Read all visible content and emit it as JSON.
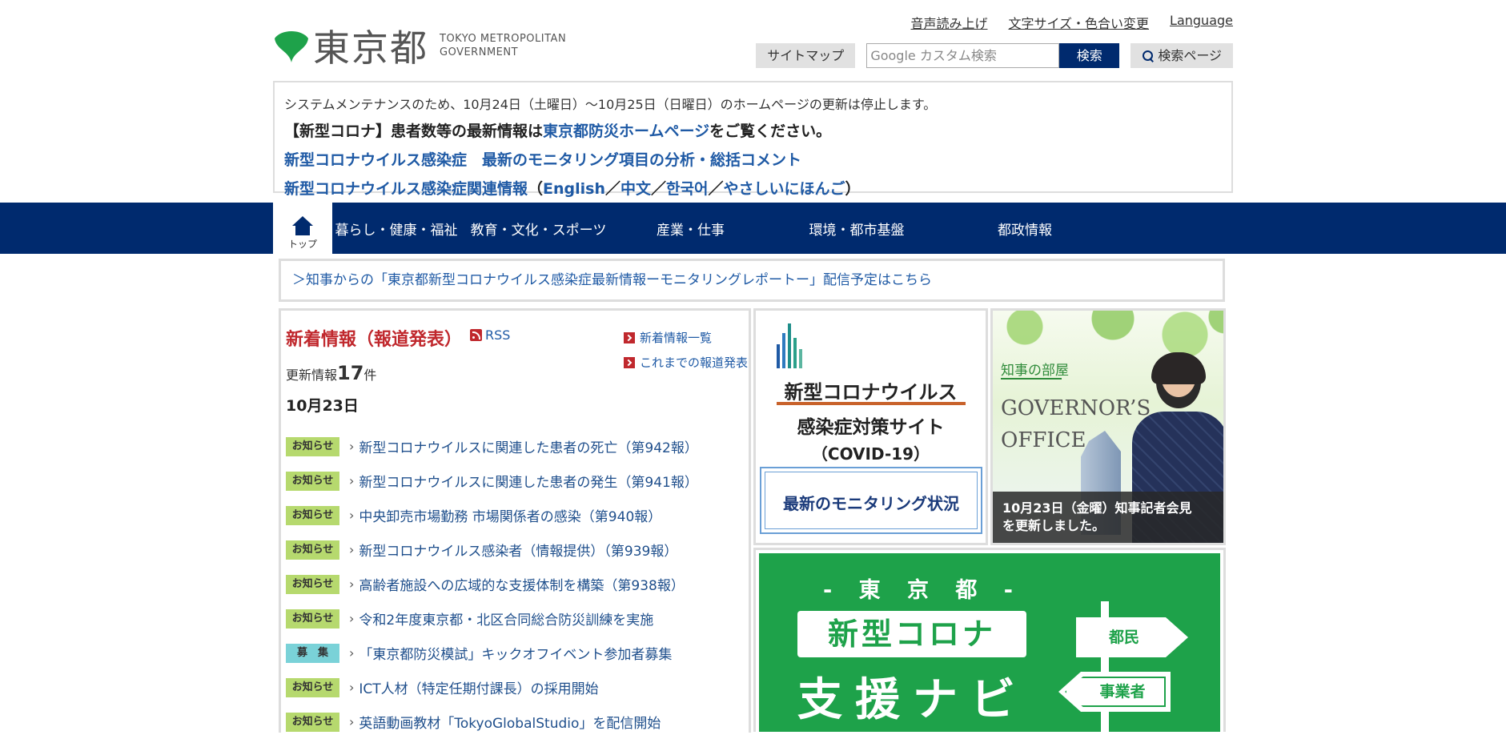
{
  "header": {
    "logo_text": "東京都",
    "logo_en_line1": "TOKYO METROPOLITAN",
    "logo_en_line2": "GOVERNMENT",
    "util_links": [
      "音声読み上げ",
      "文字サイズ・色合い変更",
      "Language"
    ],
    "sitemap_label": "サイトマップ",
    "search_placeholder": "Google カスタム検索",
    "search_button": "検索",
    "search_page_label": "検索ページ"
  },
  "notice": {
    "line1": "システムメンテナンスのため、10月24日（土曜日）～10月25日（日曜日）のホームページの更新は停止します。",
    "line2_pre": "【新型コロナ】患者数等の最新情報は",
    "line2_link": "東京都防災ホームページ",
    "line2_post": "をご覧ください。",
    "line3": "新型コロナウイルス感染症　最新のモニタリング項目の分析・総括コメント",
    "line4_link": "新型コロナウイルス感染症関連情報",
    "line4_open": "（",
    "line4_lang1": "English",
    "line4_sep1": "／",
    "line4_lang2": "中文",
    "line4_sep2": "／",
    "line4_lang3": "한국어",
    "line4_sep3": "／",
    "line4_lang4": "やさしいにほんご",
    "line4_close": "）"
  },
  "nav": {
    "home_label": "トップ",
    "items": [
      "暮らし・健康・福祉",
      "教育・文化・スポーツ",
      "産業・仕事",
      "環境・都市基盤",
      "都政情報"
    ]
  },
  "governor_banner": "＞知事からの「東京都新型コロナウイルス感染症最新情報ーモニタリングレポートー」配信予定はこちら",
  "news": {
    "title": "新着情報（報道発表）",
    "rss_label": "RSS",
    "link_all": "新着情報一覧",
    "link_archive": "これまでの報道発表",
    "update_prefix": "更新情報",
    "update_count": "17",
    "update_suffix": "件",
    "date": "10月23日",
    "items": [
      {
        "tag": "お知らせ",
        "text": "新型コロナウイルスに関連した患者の死亡（第942報）"
      },
      {
        "tag": "お知らせ",
        "text": "新型コロナウイルスに関連した患者の発生（第941報）"
      },
      {
        "tag": "お知らせ",
        "text": "中央卸売市場勤務 市場関係者の感染（第940報）"
      },
      {
        "tag": "お知らせ",
        "text": "新型コロナウイルス感染者（情報提供）（第939報）"
      },
      {
        "tag": "お知らせ",
        "text": "高齢者施設への広域的な支援体制を構築（第938報）"
      },
      {
        "tag": "お知らせ",
        "text": "令和2年度東京都・北区合同総合防災訓練を実施"
      },
      {
        "tag": "募　集",
        "text": "「東京都防災模試」キックオフイベント参加者募集"
      },
      {
        "tag": "お知らせ",
        "text": "ICT人材（特定任期付課長）の採用開始"
      },
      {
        "tag": "お知らせ",
        "text": "英語動画教材「TokyoGlobalStudio」を配信開始"
      }
    ]
  },
  "covid_card": {
    "line1": "新型コロナウイルス",
    "line2": "感染症対策サイト",
    "line3": "（COVID-19）",
    "box": "最新のモニタリング状況"
  },
  "governor_card": {
    "label": "知事の部屋",
    "en_line1": "GOVERNOR’S",
    "en_line2": "OFFICE",
    "caption_line1": "10月23日（金曜）知事記者会見",
    "caption_line2": "を更新しました。"
  },
  "support_navi": {
    "line1": "- 東 京 都 -",
    "line2": "新型コロナ",
    "line3": "支援ナビ",
    "sign1": "都民",
    "sign2": "事業者"
  },
  "colors": {
    "navy": "#002a6e",
    "link": "#1f5aa5",
    "news_red": "#c0282d",
    "tag_green": "#b6d96e",
    "tag_blue": "#7ad2d8",
    "navi_green": "#1ea24a"
  }
}
